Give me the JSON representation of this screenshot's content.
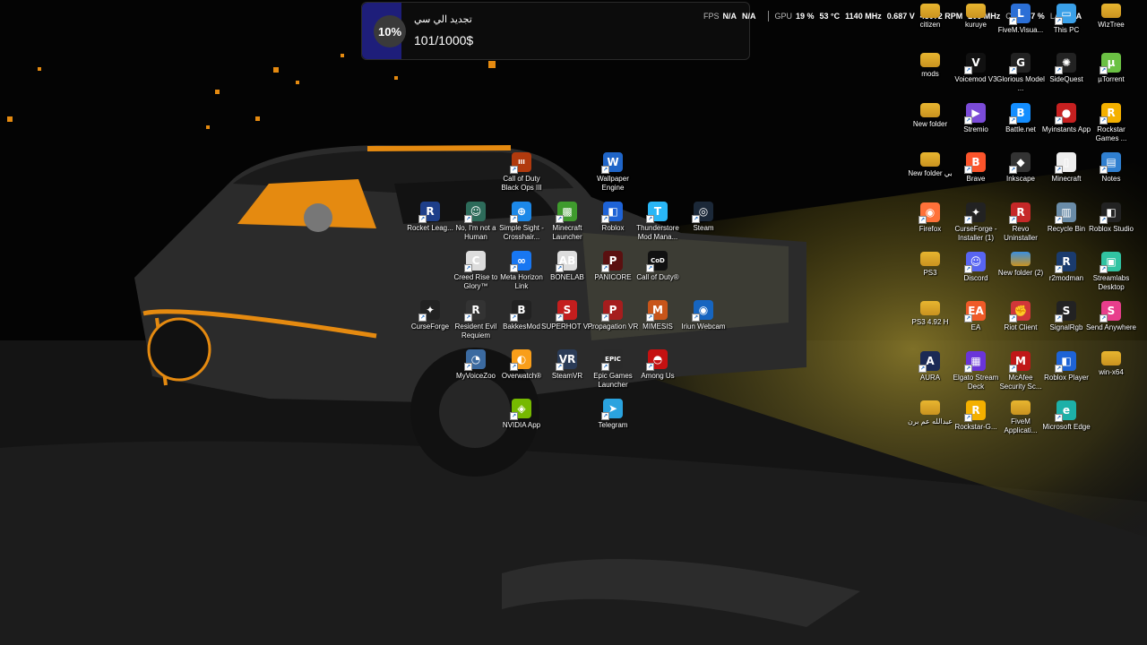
{
  "promo": {
    "percent": "10%",
    "title": "تجديد الي سي",
    "amount": "101/1000$"
  },
  "hud": {
    "fps_label": "FPS",
    "fps_value": "N/A",
    "fps_extra": "N/A",
    "gpu_label": "GPU",
    "gpu_load": "19 %",
    "gpu_temp": "53 °C",
    "gpu_clock": "1140 MHz",
    "gpu_volt": "0.687 V",
    "gpu_fan": "43072 RPM",
    "cpu_clock": "200 MHz",
    "cpu_label": "CPU",
    "cpu_load": "47 %",
    "lat_label": "LAT",
    "lat_value": "N/A"
  },
  "icons": [
    {
      "label": "citizen",
      "glyph": "folder",
      "color": "#e8b530"
    },
    {
      "label": "kuruye",
      "glyph": "folder",
      "color": "#e8b530"
    },
    {
      "label": "FiveM.Visua...",
      "glyph": "L",
      "color": "#2b6fd6"
    },
    {
      "label": "This PC",
      "glyph": "▭",
      "color": "#3aa0e8"
    },
    {
      "label": "WizTree",
      "glyph": "folder",
      "color": "#e8b530"
    },
    {
      "label": "mods",
      "glyph": "folder",
      "color": "#e8b530"
    },
    {
      "label": "Voicemod V3",
      "glyph": "V",
      "color": "#111"
    },
    {
      "label": "Glorious Model ...",
      "glyph": "G",
      "color": "#222"
    },
    {
      "label": "SideQuest",
      "glyph": "✺",
      "color": "#222"
    },
    {
      "label": "µTorrent",
      "glyph": "µ",
      "color": "#6bc144"
    },
    {
      "label": "New folder",
      "glyph": "folder",
      "color": "#e8b530"
    },
    {
      "label": "Stremio",
      "glyph": "▶",
      "color": "#7b4bd8"
    },
    {
      "label": "Battle.net",
      "glyph": "B",
      "color": "#148eff"
    },
    {
      "label": "Myinstants App",
      "glyph": "●",
      "color": "#c62020"
    },
    {
      "label": "Rockstar Games ...",
      "glyph": "R",
      "color": "#f4b000"
    },
    {
      "label": "New folder بي",
      "glyph": "folder",
      "color": "#e8b530"
    },
    {
      "label": "Brave",
      "glyph": "B",
      "color": "#fb542b"
    },
    {
      "label": "Inkscape",
      "glyph": "◆",
      "color": "#333"
    },
    {
      "label": "Minecraft",
      "glyph": "▯",
      "color": "#eee"
    },
    {
      "label": "Notes",
      "glyph": "▤",
      "color": "#2f7fd0"
    },
    {
      "label": "Firefox",
      "glyph": "◉",
      "color": "#ff7139"
    },
    {
      "label": "CurseForge - Installer (1)",
      "glyph": "✦",
      "color": "#222"
    },
    {
      "label": "Revo Uninstaller",
      "glyph": "R",
      "color": "#c62828"
    },
    {
      "label": "Recycle Bin",
      "glyph": "▥",
      "color": "#6a8ca8"
    },
    {
      "label": "Roblox Studio",
      "glyph": "◧",
      "color": "#222"
    },
    {
      "label": "PS3",
      "glyph": "folder",
      "color": "#e8b530"
    },
    {
      "label": "Discord",
      "glyph": "☺",
      "color": "#5865f2"
    },
    {
      "label": "New folder (2)",
      "glyph": "folder",
      "color": "#3a8fe0"
    },
    {
      "label": "r2modman",
      "glyph": "R",
      "color": "#1a3b6e"
    },
    {
      "label": "Streamlabs Desktop",
      "glyph": "▣",
      "color": "#31c3a2"
    },
    {
      "label": "PS3 4.92 H",
      "glyph": "folder",
      "color": "#e8b530"
    },
    {
      "label": "EA",
      "glyph": "EA",
      "color": "#f05a28"
    },
    {
      "label": "Riot Client",
      "glyph": "✊",
      "color": "#d13639"
    },
    {
      "label": "SignalRgb",
      "glyph": "S",
      "color": "#222"
    },
    {
      "label": "Send Anywhere",
      "glyph": "S",
      "color": "#e83e8c"
    },
    {
      "label": "AURA",
      "glyph": "A",
      "color": "#1b2a55"
    },
    {
      "label": "Elgato Stream Deck",
      "glyph": "▦",
      "color": "#6a34d9"
    },
    {
      "label": "McAfee Security Sc...",
      "glyph": "M",
      "color": "#c01818"
    },
    {
      "label": "Roblox Player",
      "glyph": "◧",
      "color": "#1e63d6"
    },
    {
      "label": "win-x64",
      "glyph": "folder",
      "color": "#e8b530"
    },
    {
      "label": "عبدالله عم برن",
      "glyph": "folder",
      "color": "#e8b530"
    },
    {
      "label": "Rockstar-G...",
      "glyph": "R",
      "color": "#f4b000"
    },
    {
      "label": "FiveM Applicati...",
      "glyph": "folder",
      "color": "#e8b530"
    },
    {
      "label": "Microsoft Edge",
      "glyph": "e",
      "color": "#1db0a8"
    },
    {
      "label": "Call of Duty Black Ops III",
      "glyph": "III",
      "color": "#b13a0e"
    },
    {
      "label": "Wallpaper Engine",
      "glyph": "W",
      "color": "#1f65c8"
    },
    {
      "label": "Rocket Leag...",
      "glyph": "R",
      "color": "#1e3f8a"
    },
    {
      "label": "No, I'm not a Human",
      "glyph": "☺",
      "color": "#2d6b5a"
    },
    {
      "label": "Simple Sight - Crosshair...",
      "glyph": "⊕",
      "color": "#1c88e8"
    },
    {
      "label": "Minecraft Launcher",
      "glyph": "▩",
      "color": "#3f9b2d"
    },
    {
      "label": "Roblox",
      "glyph": "◧",
      "color": "#1e63d6"
    },
    {
      "label": "Thunderstore Mod Mana...",
      "glyph": "T",
      "color": "#29b6f6"
    },
    {
      "label": "Steam",
      "glyph": "◎",
      "color": "#1b2838"
    },
    {
      "label": "Creed Rise to Glory™",
      "glyph": "C",
      "color": "#ddd"
    },
    {
      "label": "Meta Horizon Link",
      "glyph": "∞",
      "color": "#1877f2"
    },
    {
      "label": "BONELAB",
      "glyph": "AB",
      "color": "#ddd"
    },
    {
      "label": "PANICORE",
      "glyph": "P",
      "color": "#5a1010"
    },
    {
      "label": "Call of Duty®",
      "glyph": "CoD",
      "color": "#111"
    },
    {
      "label": "CurseForge",
      "glyph": "✦",
      "color": "#222"
    },
    {
      "label": "Resident Evil Requiem",
      "glyph": "R",
      "color": "#333"
    },
    {
      "label": "BakkesMod",
      "glyph": "B",
      "color": "#222"
    },
    {
      "label": "SUPERHOT VR",
      "glyph": "S",
      "color": "#c41e1e"
    },
    {
      "label": "Propagation VR",
      "glyph": "P",
      "color": "#a51d1d"
    },
    {
      "label": "MIMESIS",
      "glyph": "M",
      "color": "#c8551a"
    },
    {
      "label": "Iriun Webcam",
      "glyph": "◉",
      "color": "#1665c0"
    },
    {
      "label": "MyVoiceZoo",
      "glyph": "◔",
      "color": "#3b6aa0"
    },
    {
      "label": "Overwatch®",
      "glyph": "◐",
      "color": "#f99e1a"
    },
    {
      "label": "SteamVR",
      "glyph": "VR",
      "color": "#2a3b57"
    },
    {
      "label": "Epic Games Launcher",
      "glyph": "EPIC",
      "color": "#2a2a2a"
    },
    {
      "label": "Among Us",
      "glyph": "◓",
      "color": "#c51111"
    },
    {
      "label": "NVIDIA App",
      "glyph": "◈",
      "color": "#76b900"
    },
    {
      "label": "Telegram",
      "glyph": "➤",
      "color": "#2aa3df"
    }
  ]
}
